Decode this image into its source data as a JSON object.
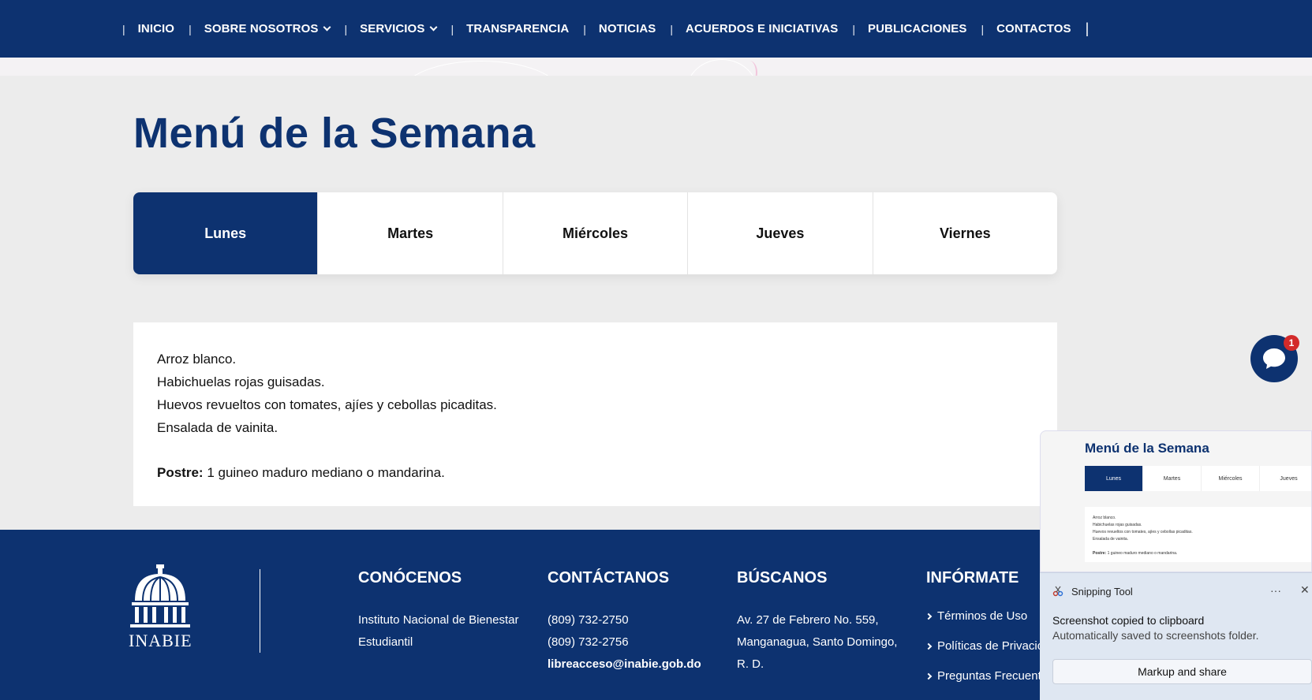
{
  "nav": {
    "items": [
      {
        "label": "INICIO",
        "dropdown": false
      },
      {
        "label": "SOBRE NOSOTROS",
        "dropdown": true
      },
      {
        "label": "SERVICIOS",
        "dropdown": true
      },
      {
        "label": "TRANSPARENCIA",
        "dropdown": false
      },
      {
        "label": "NOTICIAS",
        "dropdown": false
      },
      {
        "label": "ACUERDOS E INICIATIVAS",
        "dropdown": false
      },
      {
        "label": "PUBLICACIONES",
        "dropdown": false
      },
      {
        "label": "CONTACTOS",
        "dropdown": false
      }
    ],
    "separator": "|"
  },
  "main": {
    "title": "Menú de la Semana",
    "tabs": [
      "Lunes",
      "Martes",
      "Miércoles",
      "Jueves",
      "Viernes"
    ],
    "active_tab": "Lunes",
    "menu_lines": [
      "Arroz blanco.",
      "Habichuelas rojas guisadas.",
      "Huevos revueltos con tomates, ajíes y cebollas picaditas.",
      "Ensalada de vainita."
    ],
    "dessert_label": "Postre:",
    "dessert_text": "1 guineo maduro mediano o mandarina."
  },
  "chat": {
    "badge": "1",
    "icon": "chat-icon"
  },
  "footer": {
    "logo_text": "INABIE",
    "conocenos": {
      "heading": "CONÓCENOS",
      "lines": [
        "Instituto Nacional de Bienestar",
        "Estudiantil"
      ]
    },
    "contactanos": {
      "heading": "CONTÁCTANOS",
      "phone1": "(809) 732-2750",
      "phone2": "(809) 732-2756",
      "email": "libreacceso@inabie.gob.do"
    },
    "buscanos": {
      "heading": "BÚSCANOS",
      "lines": [
        "Av. 27 de Febrero No. 559,",
        "Manganagua, Santo Domingo,",
        "R. D."
      ]
    },
    "informate": {
      "heading": "INFÓRMATE",
      "links": [
        "Términos de Uso",
        "Políticas de Privacio",
        "Preguntas Frecuent"
      ]
    }
  },
  "snip_preview": {
    "title": "Menú de la Semana",
    "tabs": [
      "Lunes",
      "Martes",
      "Miércoles",
      "Jueves"
    ],
    "lines": [
      "Arroz blanco.",
      "Habichuelas rojas guisadas.",
      "Huevos revueltos con tomates, ajíes y cebollas picaditas.",
      "Ensalada de vainita."
    ],
    "dessert_label": "Postre:",
    "dessert_text": "1 guineo maduro mediano o mandarina."
  },
  "toast": {
    "app_name": "Snipping Tool",
    "more": "···",
    "close": "✕",
    "title": "Screenshot copied to clipboard",
    "subtitle": "Automatically saved to screenshots folder.",
    "button": "Markup and share"
  },
  "colors": {
    "brand_navy": "#0d3270",
    "page_bg": "#ececec",
    "badge_red": "#d32a2a"
  }
}
